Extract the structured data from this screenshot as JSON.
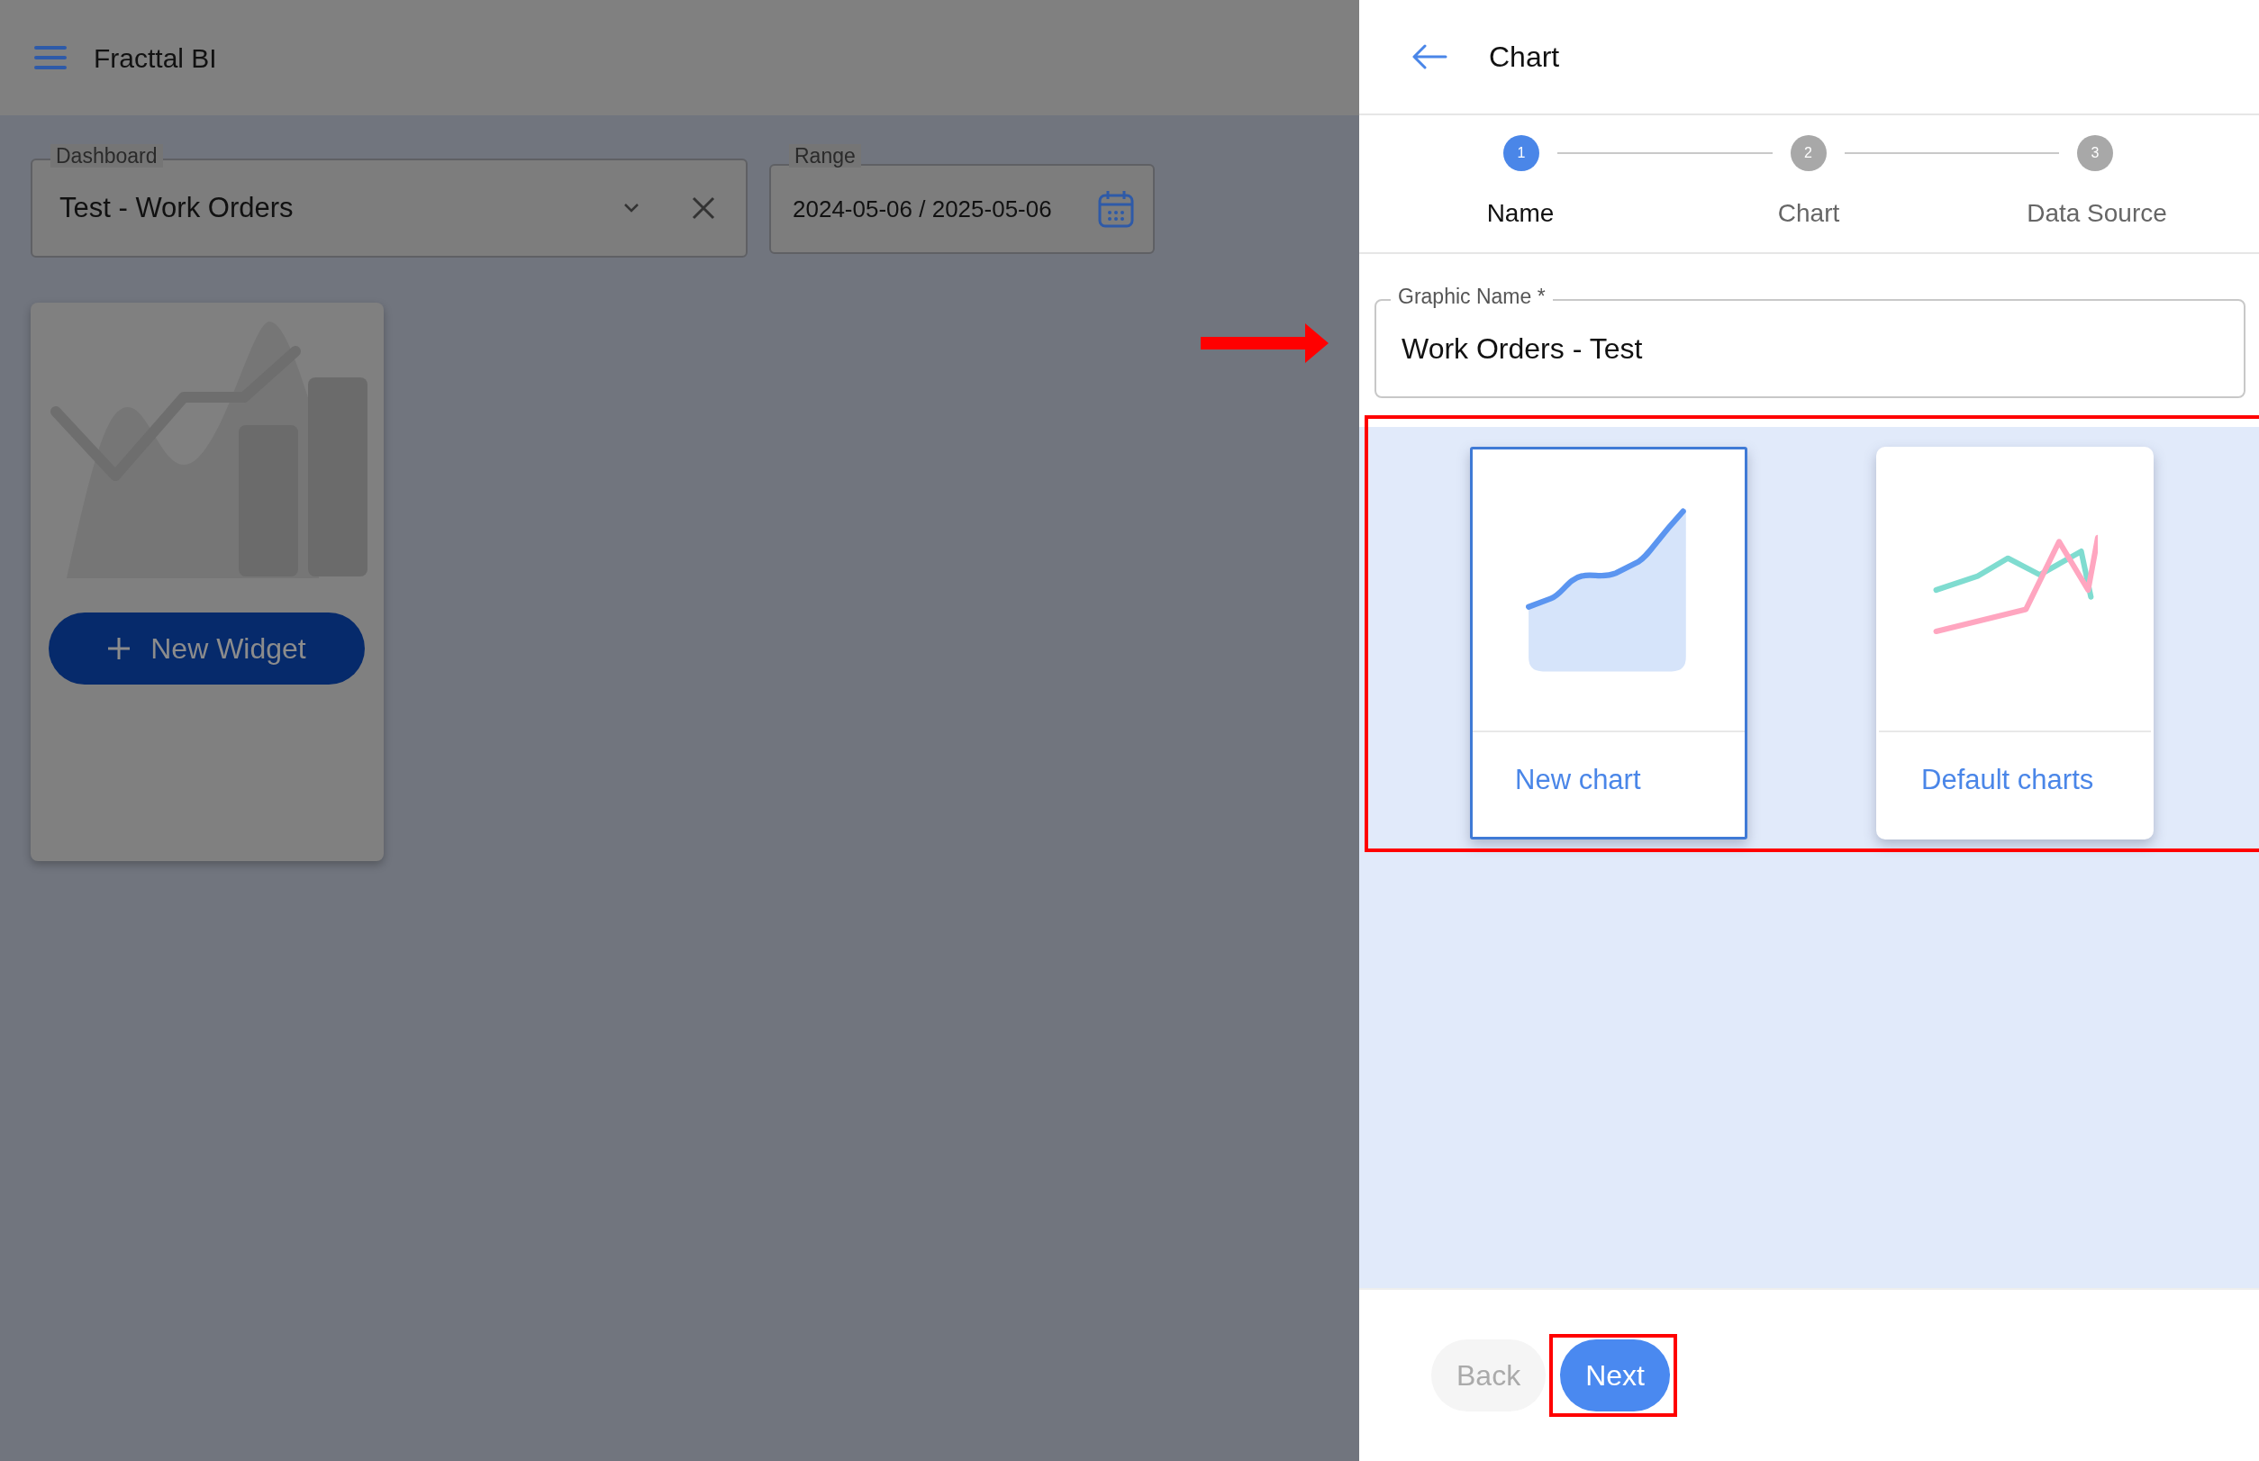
{
  "app_bar": {
    "title": "Fracttal BI"
  },
  "filters": [
    {
      "kind": "select",
      "label": "Dashboard",
      "value": "Test - Work Orders"
    },
    {
      "kind": "date_range",
      "label": "Range",
      "value": "2024-05-06 / 2025-05-06"
    }
  ],
  "widget_card": {
    "button": "New Widget"
  },
  "panel": {
    "title": "Chart",
    "steps": [
      {
        "number": "1",
        "label": "Name",
        "selected": true
      },
      {
        "number": "2",
        "label": "Chart",
        "selected": false
      },
      {
        "number": "3",
        "label": "Data Source",
        "selected": false
      }
    ],
    "name_field": {
      "label": "Graphic Name *",
      "value": "Work Orders - Test",
      "pointed": true
    },
    "options_highlighted": true,
    "options": [
      {
        "kind": "area",
        "label": "New chart",
        "selected": true
      },
      {
        "kind": "lines",
        "label": "Default charts",
        "selected": false
      }
    ],
    "buttons": [
      {
        "label": "Back",
        "disabled": true,
        "highlighted": false
      },
      {
        "label": "Next",
        "disabled": false,
        "highlighted": true
      }
    ]
  }
}
